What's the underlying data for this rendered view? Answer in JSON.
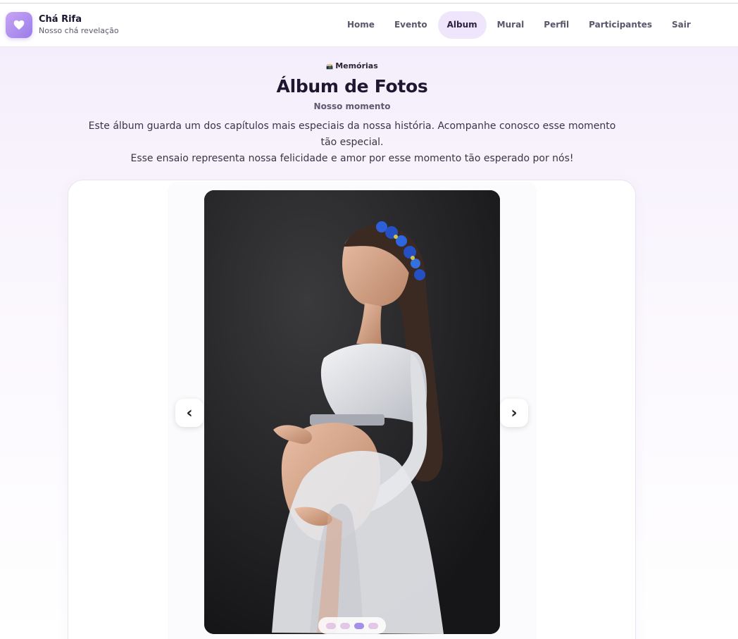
{
  "brand": {
    "title": "Chá Rifa",
    "subtitle": "Nosso chá revelação",
    "icon": "heart-icon"
  },
  "nav": {
    "items": [
      {
        "label": "Home",
        "active": false
      },
      {
        "label": "Evento",
        "active": false
      },
      {
        "label": "Album",
        "active": true
      },
      {
        "label": "Mural",
        "active": false
      },
      {
        "label": "Perfil",
        "active": false
      },
      {
        "label": "Participantes",
        "active": false
      },
      {
        "label": "Sair",
        "active": false
      }
    ]
  },
  "hero": {
    "kicker_icon": "📸",
    "kicker": "Memórias",
    "title": "Álbum de Fotos",
    "subtitle": "Nosso momento",
    "description_1": "Este álbum guarda um dos capítulos mais especiais da nossa história. Acompanhe conosco esse momento tão especial.",
    "description_2": "Esse ensaio representa nossa felicidade e amor por esse momento tão esperado por nós!"
  },
  "carousel": {
    "prev_label": "‹",
    "next_label": "›",
    "slide_count": 4,
    "active_index": 2
  },
  "colors": {
    "accent": "#9b7ce8",
    "nav_active_bg": "#efe6fc",
    "dot_inactive": "#e2c7e6",
    "dot_active": "#a58fe8"
  }
}
